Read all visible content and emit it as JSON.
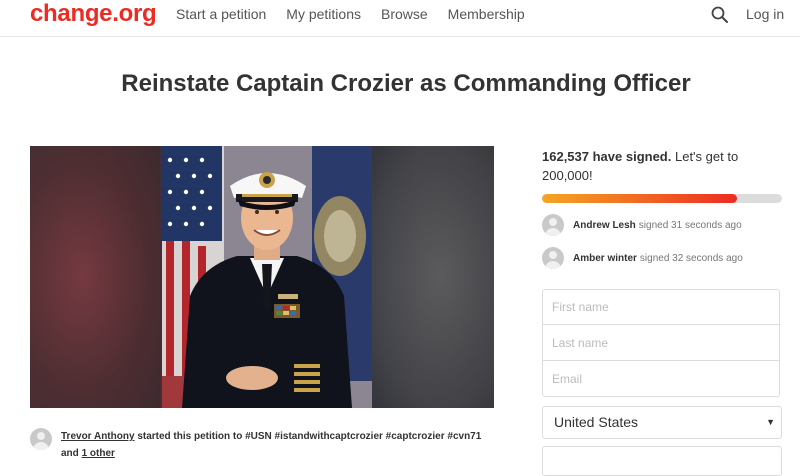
{
  "header": {
    "logo": "change.org",
    "nav": [
      "Start a petition",
      "My petitions",
      "Browse",
      "Membership"
    ],
    "search_icon": "search-icon",
    "login_label": "Log in",
    "logo_color": "#ec2c22"
  },
  "petition": {
    "title": "Reinstate Captain Crozier as Commanding Officer"
  },
  "signatures": {
    "count": "162,537 have signed.",
    "goal_text": "Let's get to 200,000!",
    "progress_fraction": 0.8127,
    "recent": [
      {
        "name": "Andrew Lesh",
        "text": "signed 31 seconds ago"
      },
      {
        "name": "Amber winter",
        "text": "signed 32 seconds ago"
      }
    ]
  },
  "form": {
    "first_name_placeholder": "First name",
    "last_name_placeholder": "Last name",
    "email_placeholder": "Email",
    "country_value": "United States"
  },
  "starter": {
    "name": "Trevor Anthony",
    "middle": "started this petition to",
    "tags": "#USN #istandwithcaptcrozier #captcrozier #cvn71",
    "and": "and",
    "other": "1 other"
  }
}
